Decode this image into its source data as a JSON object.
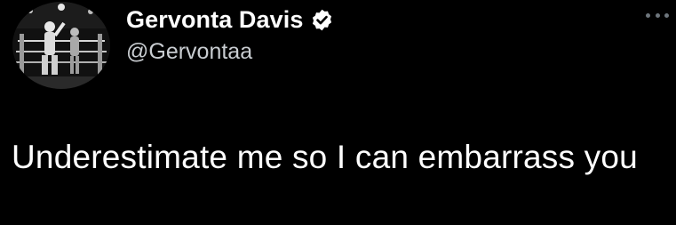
{
  "tweet": {
    "author": {
      "display_name": "Gervonta Davis",
      "handle": "@Gervontaa",
      "verified": true,
      "verified_icon": "verified-badge-icon",
      "avatar_icon": "boxing-ring-avatar"
    },
    "more_icon": "more-options-icon",
    "text": "Underestimate me so I can embarrass you"
  },
  "colors": {
    "background": "#000000",
    "text_primary": "#ffffff",
    "text_secondary": "#c9cdd1",
    "icon_muted": "#6e767d"
  }
}
